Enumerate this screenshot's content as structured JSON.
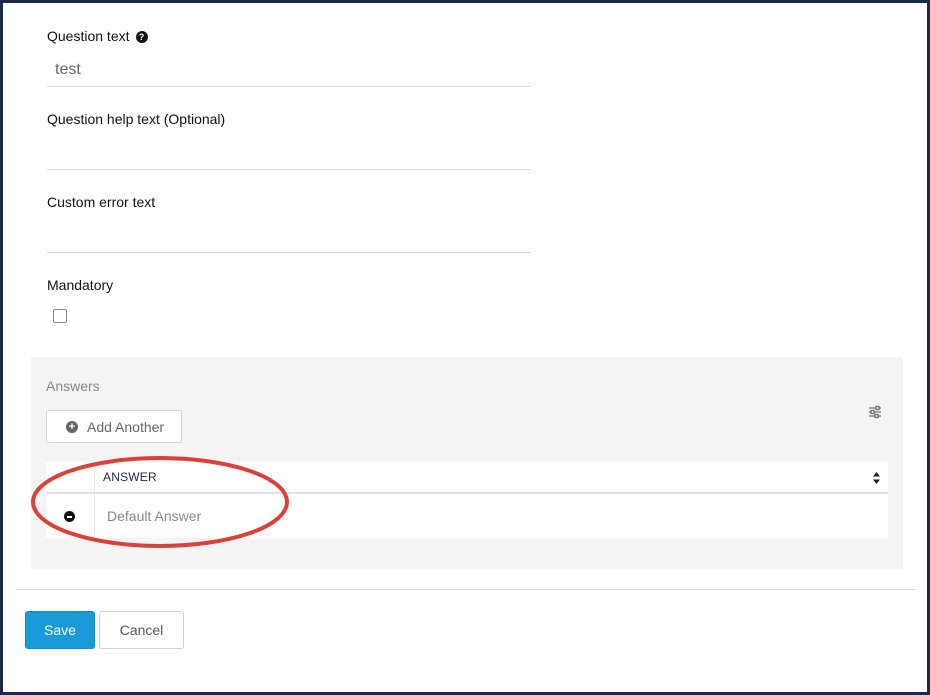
{
  "form": {
    "question_text_label": "Question text",
    "question_text_value": "test",
    "question_help_label": "Question help text (Optional)",
    "question_help_value": "",
    "custom_error_label": "Custom error text",
    "custom_error_value": "",
    "mandatory_label": "Mandatory",
    "mandatory_checked": false
  },
  "answers": {
    "title": "Answers",
    "add_another_label": "Add Another",
    "column_header": "ANSWER",
    "rows": [
      {
        "value": "Default Answer"
      }
    ]
  },
  "footer": {
    "save_label": "Save",
    "cancel_label": "Cancel"
  },
  "colors": {
    "frame_border": "#1c2a4a",
    "primary_button": "#1a9ad6",
    "annotation": "#d9423a",
    "panel_background": "#f4f4f4"
  },
  "icons": {
    "question_help": "question-circle-icon",
    "add_another": "plus-circle-icon",
    "table_settings": "sliders-icon",
    "sort": "sort-icon",
    "remove_row": "minus-circle-icon"
  }
}
